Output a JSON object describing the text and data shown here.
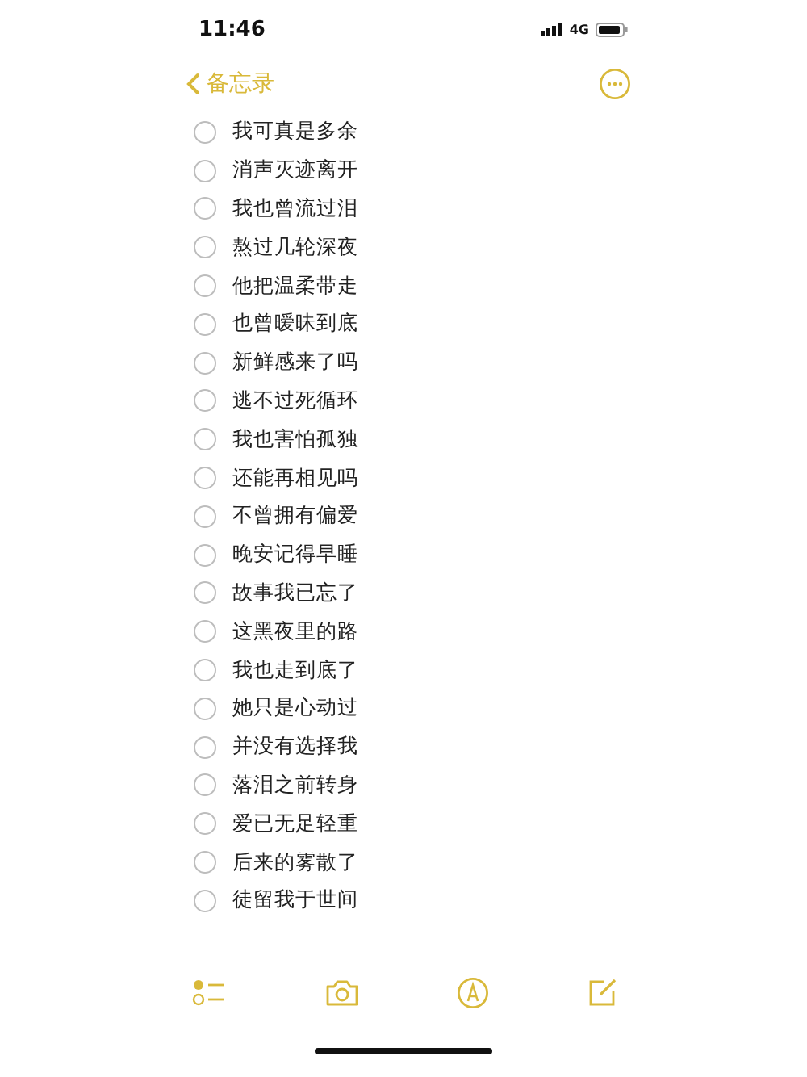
{
  "status_bar": {
    "time": "11:46",
    "network": "4G"
  },
  "nav": {
    "back_label": "备忘录"
  },
  "checklist": [
    {
      "text": "我可真是多余",
      "checked": false
    },
    {
      "text": "消声灭迹离开",
      "checked": false
    },
    {
      "text": "我也曾流过泪",
      "checked": false
    },
    {
      "text": "熬过几轮深夜",
      "checked": false
    },
    {
      "text": "他把温柔带走",
      "checked": false
    },
    {
      "text": "也曾暧昧到底",
      "checked": false
    },
    {
      "text": "新鲜感来了吗",
      "checked": false
    },
    {
      "text": "逃不过死循环",
      "checked": false
    },
    {
      "text": "我也害怕孤独",
      "checked": false
    },
    {
      "text": "还能再相见吗",
      "checked": false
    },
    {
      "text": "不曾拥有偏爱",
      "checked": false
    },
    {
      "text": "晚安记得早睡",
      "checked": false
    },
    {
      "text": "故事我已忘了",
      "checked": false
    },
    {
      "text": "这黑夜里的路",
      "checked": false
    },
    {
      "text": "我也走到底了",
      "checked": false
    },
    {
      "text": "她只是心动过",
      "checked": false
    },
    {
      "text": "并没有选择我",
      "checked": false
    },
    {
      "text": "落泪之前转身",
      "checked": false
    },
    {
      "text": "爱已无足轻重",
      "checked": false
    },
    {
      "text": "后来的雾散了",
      "checked": false
    },
    {
      "text": "徒留我于世间",
      "checked": false
    }
  ]
}
